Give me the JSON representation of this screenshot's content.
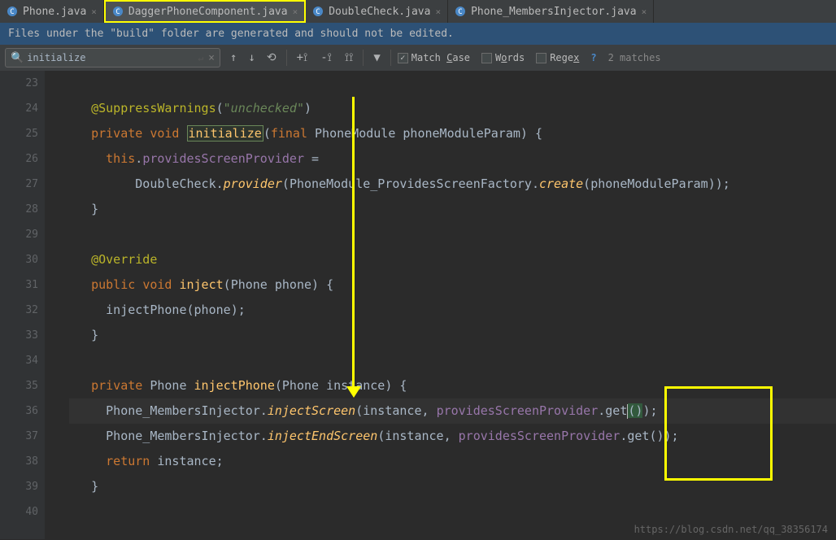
{
  "tabs": [
    {
      "label": "Phone.java",
      "close": "×"
    },
    {
      "label": "DaggerPhoneComponent.java",
      "close": "×"
    },
    {
      "label": "DoubleCheck.java",
      "close": "×"
    },
    {
      "label": "Phone_MembersInjector.java",
      "close": "×"
    }
  ],
  "notification": "Files under the \"build\" folder are generated and should not be edited.",
  "search": {
    "value": "initialize",
    "enter": "↵",
    "close": "×",
    "up": "↑",
    "down": "↓",
    "match_case": "Match Case",
    "words": "Words",
    "regex": "Regex",
    "question": "?",
    "matches": "2 matches"
  },
  "lines": {
    "start": 23,
    "numbers": [
      "23",
      "24",
      "25",
      "26",
      "27",
      "28",
      "29",
      "30",
      "31",
      "32",
      "33",
      "34",
      "35",
      "36",
      "37",
      "38",
      "39",
      "40"
    ]
  },
  "code": {
    "suppress": {
      "anno": "@SuppressWarnings",
      "paren1": "(",
      "str": "\"unchecked\"",
      "paren2": ")"
    },
    "init_sig": {
      "priv": "private ",
      "void": "void ",
      "name": "initialize",
      "paren1": "(",
      "final": "final ",
      "type": "PhoneModule ",
      "param": "phoneModuleParam",
      "paren2": ") {"
    },
    "init_body1": {
      "this": "this",
      "dot": ".",
      "field": "providesScreenProvider",
      "eq": " ="
    },
    "init_body2": {
      "cls": "DoubleCheck.",
      "m": "provider",
      "paren1": "(",
      "t": "PhoneModule_ProvidesScreenFactory.",
      "c": "create",
      "paren2": "(",
      "p": "phoneModuleParam",
      "paren3": "));"
    },
    "close1": "}",
    "override": "@Override",
    "inject_sig": {
      "pub": "public ",
      "void": "void ",
      "name": "inject",
      "paren1": "(",
      "type": "Phone ",
      "param": "phone",
      "paren2": ") {"
    },
    "inject_body": {
      "call": "injectPhone",
      "paren1": "(",
      "p": "phone",
      "paren2": ");"
    },
    "close2": "}",
    "ip_sig": {
      "priv": "private ",
      "ret": "Phone ",
      "name": "injectPhone",
      "paren1": "(",
      "type": "Phone ",
      "param": "instance",
      "paren2": ") {"
    },
    "ip_body1": {
      "cls": "Phone_MembersInjector.",
      "m": "injectScreen",
      "paren1": "(",
      "p1": "instance",
      ", ": "",
      "f": "providesScreenProvider",
      ".": "",
      "g": "get",
      "paren2": "()",
      ");": ""
    },
    "ip_body2": {
      "cls": "Phone_MembersInjector.",
      "m": "injectEndScreen",
      "paren1": "(",
      "p1": "instance",
      ", ": "",
      "f": "providesScreenProvider",
      ".": "",
      "g": "get",
      "paren2": "()",
      ");": ""
    },
    "ret": {
      "kw": "return ",
      "v": "instance",
      ";": ""
    },
    "close3": "}"
  },
  "watermark": "https://blog.csdn.net/qq_38356174"
}
